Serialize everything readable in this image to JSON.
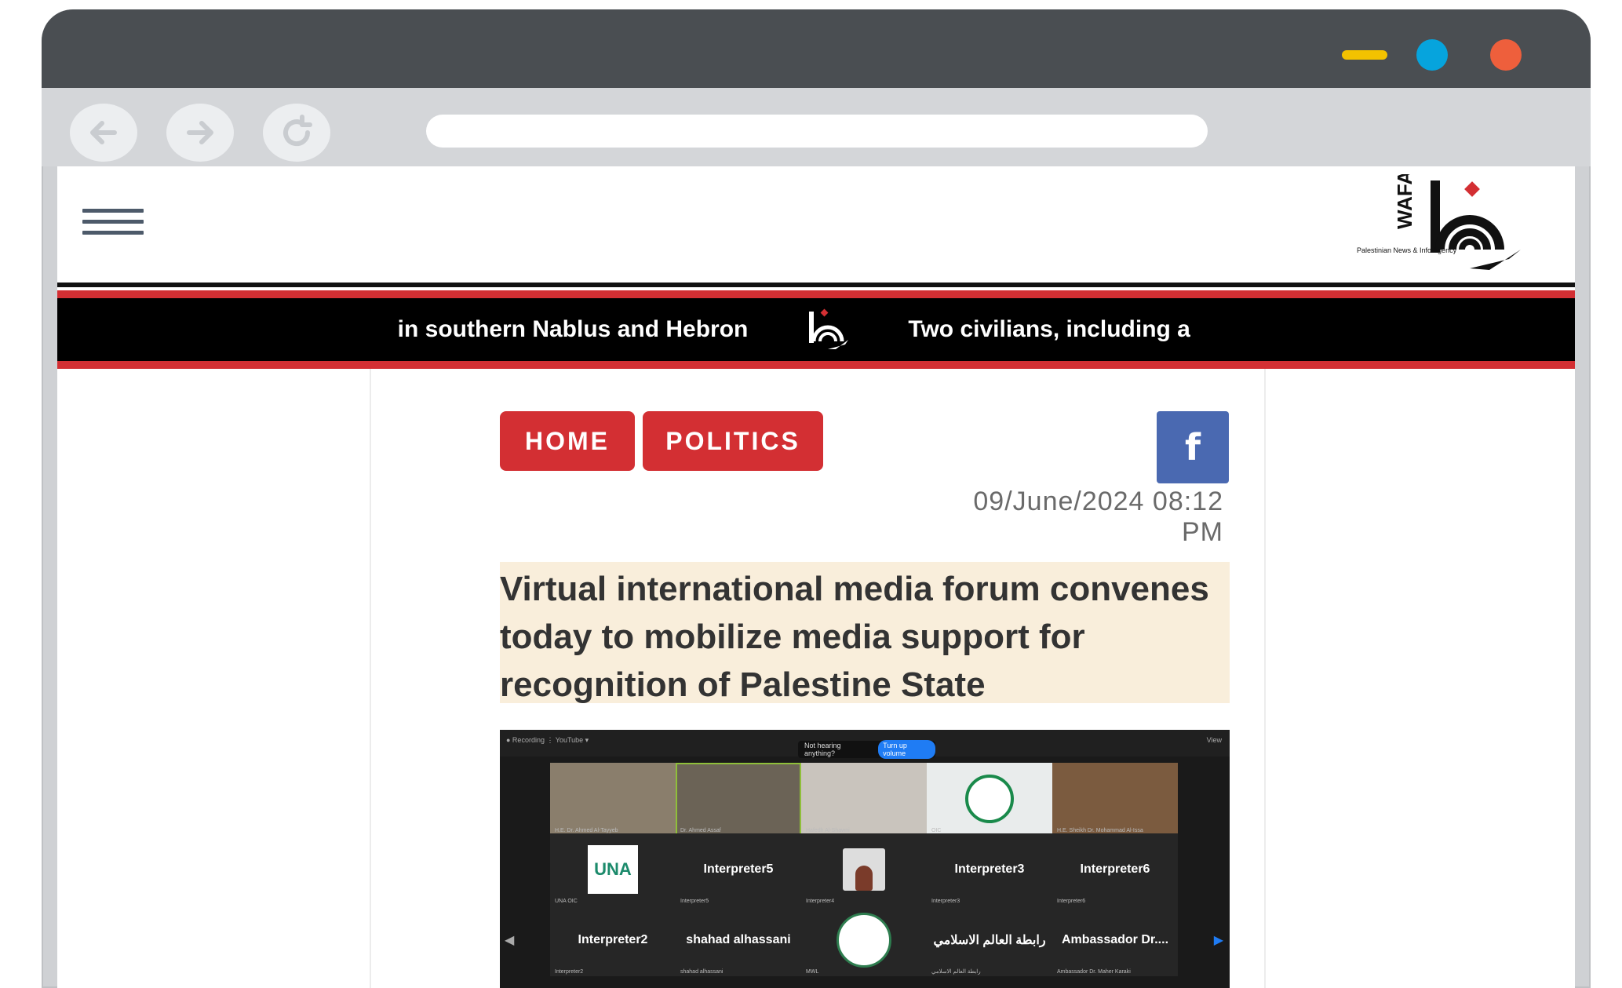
{
  "browser": {
    "controls": {
      "minimize_icon": "minimize-icon",
      "maximize_icon": "maximize-icon",
      "close_icon": "close-icon"
    },
    "nav": {
      "back_icon": "arrow-left-icon",
      "forward_icon": "arrow-right-icon",
      "reload_icon": "reload-icon"
    },
    "url": ""
  },
  "site": {
    "menu_icon": "hamburger-menu-icon",
    "logo_text": "WAFA",
    "logo_subtitle": "Palestinian News & Info Agency",
    "colors": {
      "accent_red": "#d32f33",
      "facebook": "#4a69b1",
      "headline_bg": "#f9eedb",
      "ticker_bg": "#000000"
    }
  },
  "ticker": {
    "items": [
      "nds in southern Nablus and Hebron",
      "Two civilians, including a"
    ]
  },
  "breadcrumb": {
    "home": "HOME",
    "politics": "POLITICS"
  },
  "share": {
    "facebook_glyph": "f",
    "facebook_icon": "facebook-icon"
  },
  "article": {
    "date": "09/June/2024 08:12 PM",
    "headline": "Virtual international media forum convenes today to mobilize media support for recognition of Palestine State"
  },
  "video": {
    "top_left": "● Recording   ⋮   YouTube ▾",
    "notice": "Not hearing anything?",
    "notice_button": "Turn up volume",
    "top_right": "View",
    "tiles": [
      {
        "label": "",
        "sub": "H.E. Dr. Ahmed Al-Tayyeb"
      },
      {
        "label": "",
        "sub": "Dr. Ahmed Assaf"
      },
      {
        "label": "",
        "sub": "Hafedh Al-Shawni"
      },
      {
        "label": "",
        "sub": "OIC"
      },
      {
        "label": "",
        "sub": "H.E. Sheikh Dr. Mohammad Al-Issa"
      },
      {
        "label": "UNA",
        "sub": "UNA OIC"
      },
      {
        "label": "Interpreter5",
        "sub": "Interpreter5"
      },
      {
        "label": "",
        "sub": "Interpreter4"
      },
      {
        "label": "Interpreter3",
        "sub": "Interpreter3"
      },
      {
        "label": "Interpreter6",
        "sub": "Interpreter6"
      },
      {
        "label": "Interpreter2",
        "sub": "Interpreter2"
      },
      {
        "label": "shahad alhassani",
        "sub": "shahad alhassani"
      },
      {
        "label": "",
        "sub": "MWL"
      },
      {
        "label": "رابطة العالم الاسلامي",
        "sub": "رابطة العالم الاسلامي"
      },
      {
        "label": "Ambassador  Dr....",
        "sub": "Ambassador Dr. Maher Karaki"
      }
    ]
  }
}
